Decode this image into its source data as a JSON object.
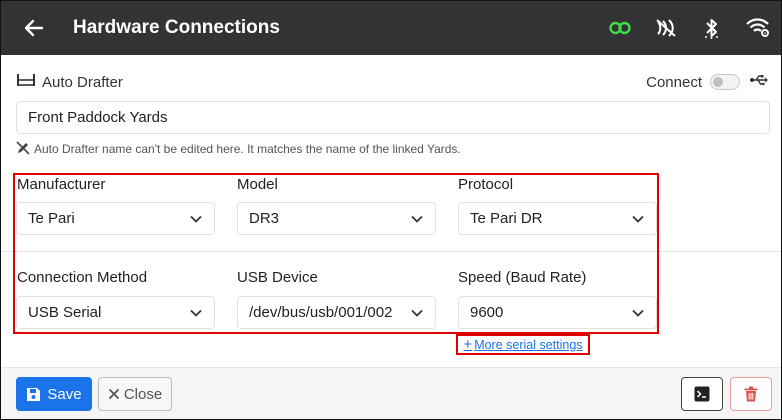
{
  "header": {
    "title": "Hardware Connections",
    "icons": [
      "back-arrow-icon",
      "link-icon",
      "nfc-off-icon",
      "bluetooth-icon",
      "wifi-settings-icon"
    ],
    "link_color": "#3ddc4a"
  },
  "drafter": {
    "label": "Auto Drafter",
    "connect_label": "Connect",
    "connected": false,
    "name_value": "Front Paddock Yards",
    "note": "Auto Drafter name can't be edited here. It matches the name of the linked Yards."
  },
  "fields": {
    "manufacturer": {
      "label": "Manufacturer",
      "value": "Te Pari"
    },
    "model": {
      "label": "Model",
      "value": "DR3"
    },
    "protocol": {
      "label": "Protocol",
      "value": "Te Pari DR"
    },
    "connection_method": {
      "label": "Connection Method",
      "value": "USB Serial"
    },
    "usb_device": {
      "label": "USB Device",
      "value": "/dev/bus/usb/001/002"
    },
    "speed": {
      "label": "Speed (Baud Rate)",
      "value": "9600"
    }
  },
  "more_settings_label": "More serial settings",
  "footer": {
    "save_label": "Save",
    "close_label": "Close"
  },
  "colors": {
    "header_bg": "#333333",
    "primary": "#1a73e8",
    "highlight": "#e00000",
    "danger": "#d9534f"
  }
}
